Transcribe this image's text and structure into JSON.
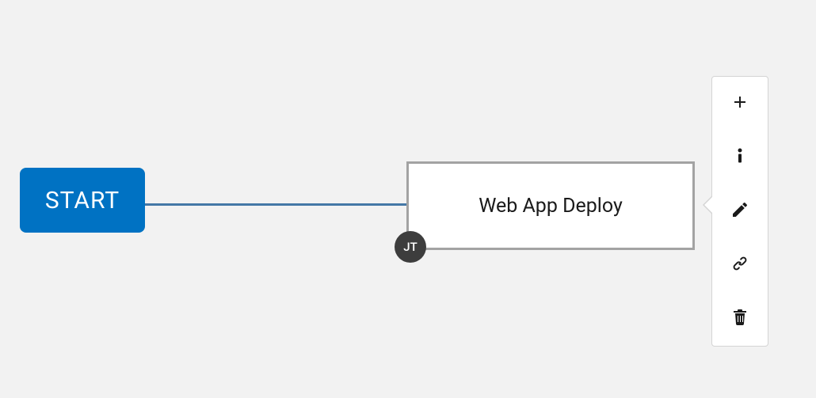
{
  "workflow": {
    "start_label": "START",
    "node": {
      "title": "Web App Deploy",
      "type_badge": "JT"
    }
  },
  "toolbar": {
    "add_tooltip": "Add",
    "info_tooltip": "Info",
    "edit_tooltip": "Edit",
    "link_tooltip": "Link",
    "delete_tooltip": "Delete"
  }
}
